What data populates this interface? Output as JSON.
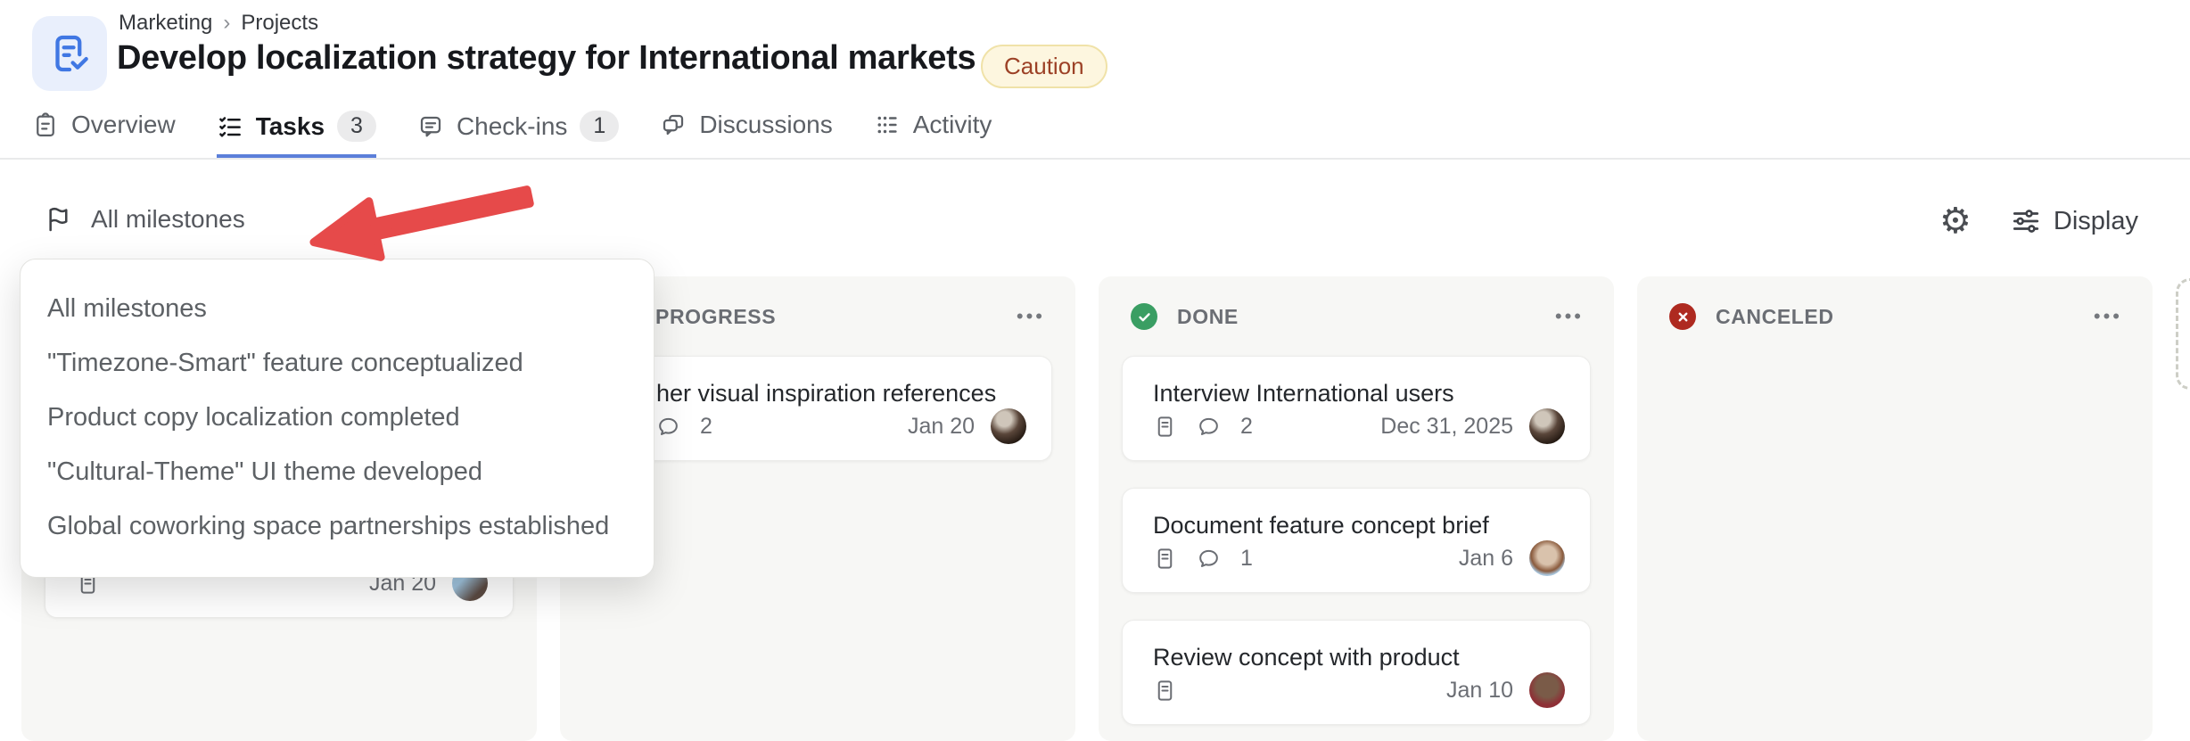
{
  "header": {
    "breadcrumb": [
      "Marketing",
      "Projects"
    ],
    "breadcrumb_separator": "›",
    "title": "Develop localization strategy for International markets",
    "status_badge": "Caution"
  },
  "tabs": {
    "overview": "Overview",
    "tasks": "Tasks",
    "tasks_count": "3",
    "checkins": "Check-ins",
    "checkins_count": "1",
    "discussions": "Discussions",
    "activity": "Activity"
  },
  "filter_bar": {
    "milestone_filter_label": "All milestones",
    "gear_icon": "⚙",
    "display_label": "Display"
  },
  "milestone_dropdown": {
    "items": [
      "All milestones",
      "\"Timezone-Smart\" feature conceptualized",
      "Product copy localization completed",
      "\"Cultural-Theme\" UI theme developed",
      "Global coworking space partnerships established"
    ]
  },
  "board": {
    "ellipsis": "•••",
    "columns": {
      "todo": {
        "card": {
          "date": "Jan 20"
        }
      },
      "in_progress": {
        "title": "PROGRESS",
        "card": {
          "title": "her visual inspiration references",
          "comments": "2",
          "date": "Jan 20"
        }
      },
      "done": {
        "title": "DONE",
        "cards": [
          {
            "title": "Interview International users",
            "comments": "2",
            "date": "Dec 31, 2025"
          },
          {
            "title": "Document feature concept brief",
            "comments": "1",
            "date": "Jan 6"
          },
          {
            "title": "Review concept with product",
            "date": "Jan 10"
          }
        ]
      },
      "canceled": {
        "title": "CANCELED"
      }
    }
  },
  "colors": {
    "accent_blue": "#5b7fd9",
    "done_green": "#3a9e63",
    "canceled_red": "#ae2a20",
    "arrow_red": "#e64a4a",
    "caution_text": "#9c4126",
    "caution_bg": "#fdf6df",
    "column_bg": "#f7f7f5"
  }
}
